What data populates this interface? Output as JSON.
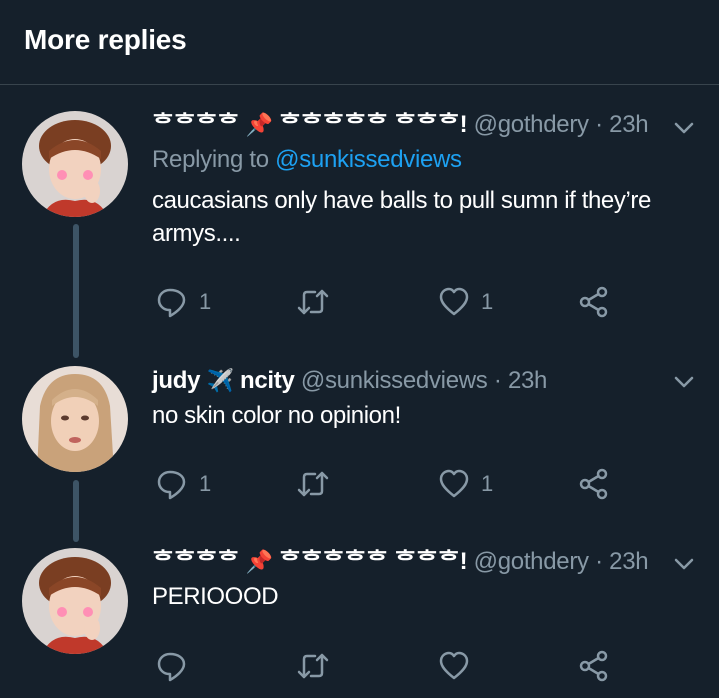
{
  "header": {
    "title": "More replies"
  },
  "tweets": [
    {
      "name": "ᄒᄒᄒᄒ",
      "emoji": "📌",
      "name2": "ᄒᄒᄒᄒᄒ ᄒᄒᄒ!",
      "handle": "@gothdery",
      "time": "23h",
      "replying_to_prefix": "Replying to",
      "replying_to": "@sunkissedviews",
      "text": "caucasians only have balls to pull sumn if they’re armys....",
      "reply_count": "1",
      "like_count": "1"
    },
    {
      "name": "judy",
      "emoji": "✈️",
      "name2": "ncity",
      "handle": "@sunkissedviews",
      "time": "23h",
      "text": "no skin color no opinion!",
      "reply_count": "1",
      "like_count": "1"
    },
    {
      "name": "ᄒᄒᄒᄒ",
      "emoji": "📌",
      "name2": "ᄒᄒᄒᄒᄒ ᄒᄒᄒ!",
      "handle": "@gothdery",
      "time": "23h",
      "text": "PERIOOOD",
      "reply_count": "",
      "like_count": ""
    }
  ],
  "icons": {
    "reply": "speech-bubble-icon",
    "retweet": "retweet-icon",
    "like": "heart-icon",
    "share": "share-icon",
    "more": "chevron-down-icon"
  },
  "colors": {
    "background": "#15202b",
    "secondary_text": "#8899a6",
    "link": "#1da1f2",
    "divider": "#38444d"
  }
}
